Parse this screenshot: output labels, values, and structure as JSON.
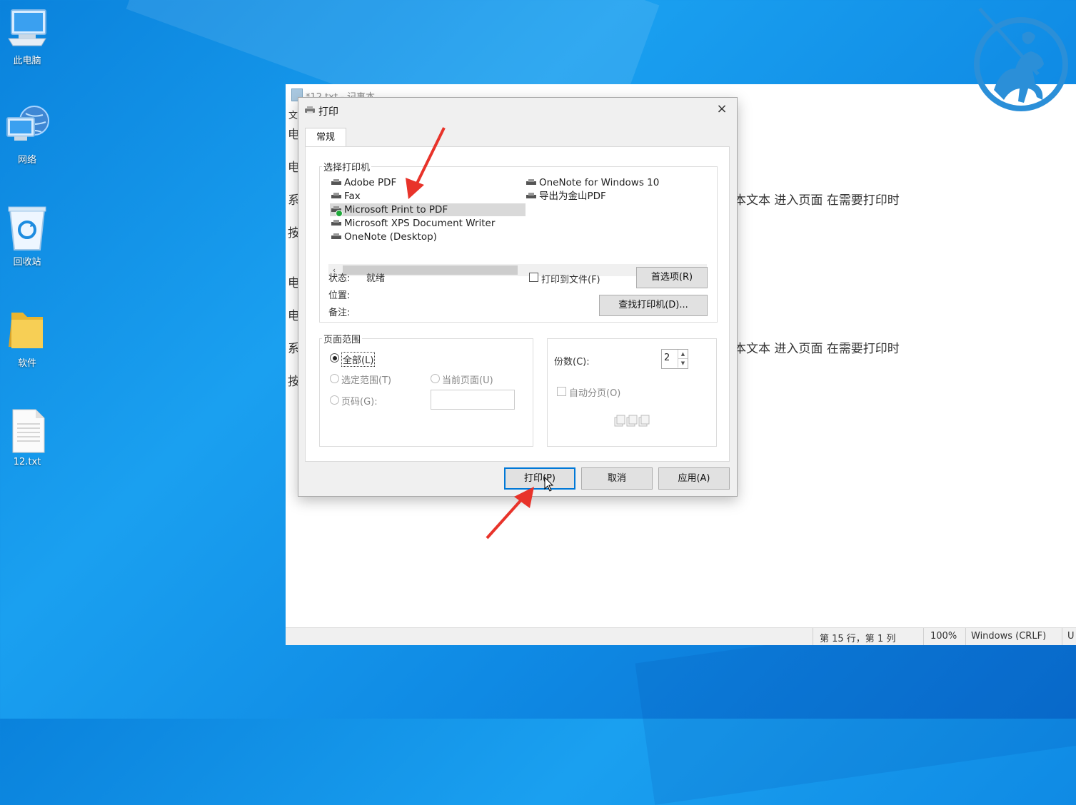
{
  "desktop": {
    "icons": [
      {
        "label": "此电脑",
        "icon": "this-pc-icon"
      },
      {
        "label": "网络",
        "icon": "network-icon"
      },
      {
        "label": "回收站",
        "icon": "recycle-bin-icon"
      },
      {
        "label": "软件",
        "icon": "folder-icon"
      },
      {
        "label": "12.txt",
        "icon": "text-file-icon"
      }
    ]
  },
  "notepad": {
    "title": "*12.txt - 记事本",
    "menu_first": "文",
    "lines": [
      "电",
      "电",
      "系",
      "按",
      "电",
      "电",
      "系",
      "按"
    ],
    "right_text_1": "本文本  进入页面  在需要打印时",
    "right_text_2": "本文本  进入页面  在需要打印时",
    "status": {
      "position": "第 15 行，第 1 列",
      "zoom": "100%",
      "line_ending": "Windows (CRLF)",
      "encoding": "U"
    }
  },
  "dialog": {
    "title": "打印",
    "close": "×",
    "tab_general": "常规",
    "select_printer": {
      "caption": "选择打印机",
      "printers_left": [
        "Adobe PDF",
        "Fax",
        "Microsoft Print to PDF",
        "Microsoft XPS Document Writer",
        "OneNote (Desktop)"
      ],
      "printers_right": [
        "OneNote for Windows 10",
        "导出为金山PDF"
      ],
      "selected": "Microsoft Print to PDF",
      "status_label": "状态:",
      "status_value": "就绪",
      "location_label": "位置:",
      "comment_label": "备注:",
      "print_to_file": "打印到文件(F)",
      "preferences": "首选项(R)",
      "find_printer": "查找打印机(D)..."
    },
    "page_range": {
      "caption": "页面范围",
      "all": "全部(L)",
      "selection": "选定范围(T)",
      "current_page": "当前页面(U)",
      "pages": "页码(G):"
    },
    "copies": {
      "label": "份数(C):",
      "value": "2",
      "collate": "自动分页(O)"
    },
    "buttons": {
      "print": "打印(P)",
      "cancel": "取消",
      "apply": "应用(A)"
    }
  },
  "colors": {
    "desktop_blue": "#0a82dc",
    "annotation_red": "#e8332a",
    "logo_blue": "#2b8fd8"
  }
}
